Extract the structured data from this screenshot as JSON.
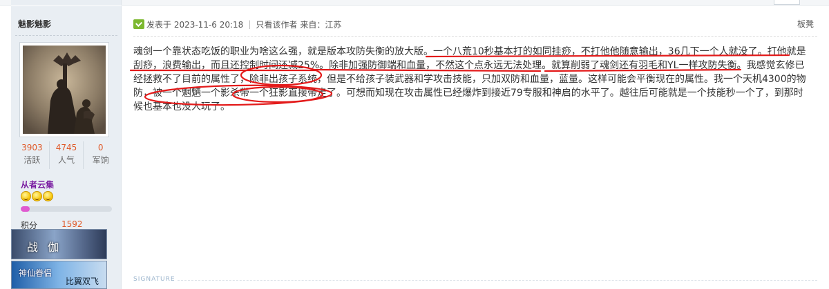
{
  "user": {
    "name": "魅影魅影",
    "stats": [
      {
        "value": "3903",
        "label": "活跃"
      },
      {
        "value": "4745",
        "label": "人气"
      },
      {
        "value": "0",
        "label": "军饷"
      }
    ],
    "group": "从者云集",
    "level_progress": 0.1,
    "credit_label": "积分",
    "credit_value": "1592",
    "medals": {
      "first": "战伽",
      "second_left": "神仙眷侣",
      "second_right": "比翼双飞"
    }
  },
  "post": {
    "meta": {
      "posted": "发表于 2023-11-6 20:18",
      "author_only": "只看该作者",
      "location": "来自：江苏"
    },
    "floor": "板凳",
    "lines": [
      "魂剑一个靠状态吃饭的职业为啥这么强，就是版本攻防失衡的放大版。一个八荒10秒基本打的如同挂痧，不打他他随意输出，36几下一个人就没了。打他就是",
      "刮痧，浪费输出，而且还控制时间还减25%。除非加强防御端和血量，不然这个点永远无法处理。就算削弱了魂剑还有羽毛和YL一样攻防失衡。我感觉玄修已",
      "经拯救不了目前的属性了，除非出孩子系统，但是不给孩子装武器和学攻击技能，只加双防和血量，蓝量。这样可能会平衡现在的属性。我一个天机4300的物",
      "防，被一个魍魉一个影杀带一个狂影直接带走了。可想而知现在攻击属性已经爆炸到接近79专服和神启的水平了。越往后可能就是一个技能秒一个了，到那时",
      "候也基本也没人玩了。"
    ]
  },
  "signature_label": "SIGNATURE",
  "colors": {
    "annotation": "#e31a1a",
    "stat_value": "#e05a2a",
    "group": "#7b1fa2",
    "sidebar_bg": "#e9eef3"
  },
  "icons": [
    "online-check-icon",
    "smiley-star-icon"
  ]
}
